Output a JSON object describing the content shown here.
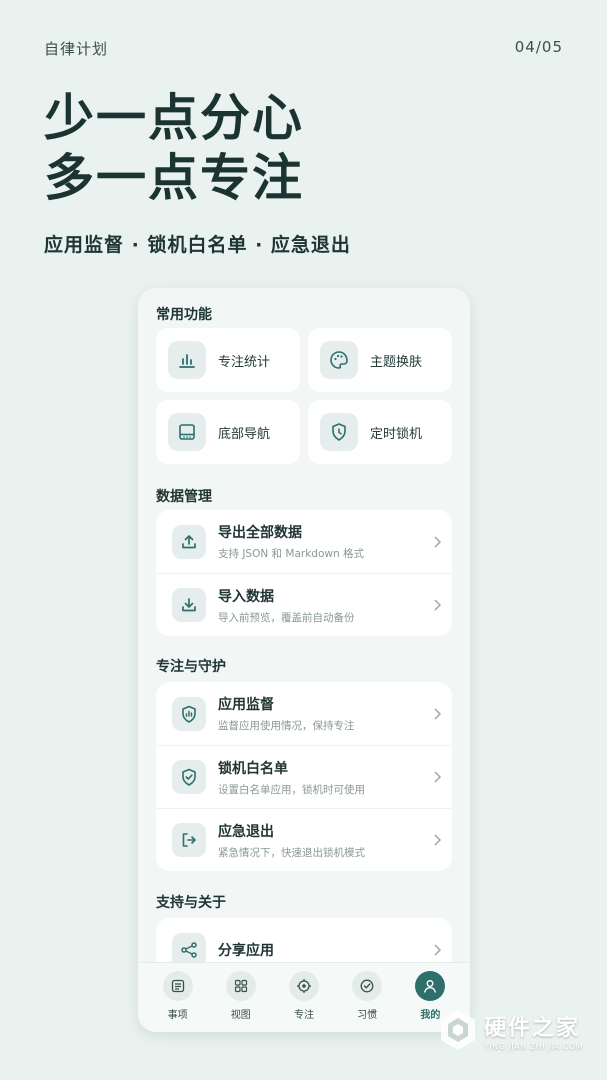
{
  "header": {
    "app_label": "自律计划",
    "page_counter": "04/05"
  },
  "headline": {
    "line1": "少一点分心",
    "line2": "多一点专注"
  },
  "tagline": "应用监督 · 锁机白名单 · 应急退出",
  "sections": {
    "common": {
      "title": "常用功能",
      "tiles": [
        {
          "label": "专注统计",
          "icon": "bar-chart-icon"
        },
        {
          "label": "主题换肤",
          "icon": "palette-icon"
        },
        {
          "label": "底部导航",
          "icon": "bottom-nav-icon"
        },
        {
          "label": "定时锁机",
          "icon": "shield-clock-icon"
        }
      ]
    },
    "data": {
      "title": "数据管理",
      "rows": [
        {
          "title": "导出全部数据",
          "subtitle": "支持 JSON 和 Markdown 格式",
          "icon": "upload-icon"
        },
        {
          "title": "导入数据",
          "subtitle": "导入前预览，覆盖前自动备份",
          "icon": "download-icon"
        }
      ]
    },
    "focus": {
      "title": "专注与守护",
      "rows": [
        {
          "title": "应用监督",
          "subtitle": "监督应用使用情况，保持专注",
          "icon": "shield-chart-icon"
        },
        {
          "title": "锁机白名单",
          "subtitle": "设置白名单应用，锁机时可使用",
          "icon": "shield-check-icon"
        },
        {
          "title": "应急退出",
          "subtitle": "紧急情况下，快速退出锁机模式",
          "icon": "exit-icon"
        }
      ]
    },
    "about": {
      "title": "支持与关于",
      "rows": [
        {
          "title": "分享应用",
          "icon": "share-icon"
        }
      ]
    }
  },
  "tabbar": {
    "items": [
      {
        "label": "事项",
        "icon": "list-icon"
      },
      {
        "label": "视图",
        "icon": "grid-icon"
      },
      {
        "label": "专注",
        "icon": "target-icon"
      },
      {
        "label": "习惯",
        "icon": "check-circle-icon"
      },
      {
        "label": "我的",
        "icon": "user-icon",
        "active": true
      }
    ]
  },
  "watermark": {
    "title": "硬件之家",
    "subtitle": "YING JIAN ZHI JIA.COM"
  },
  "colors": {
    "background": "#eaf2f0",
    "accent": "#2e6f6c",
    "text": "#1c3431"
  }
}
